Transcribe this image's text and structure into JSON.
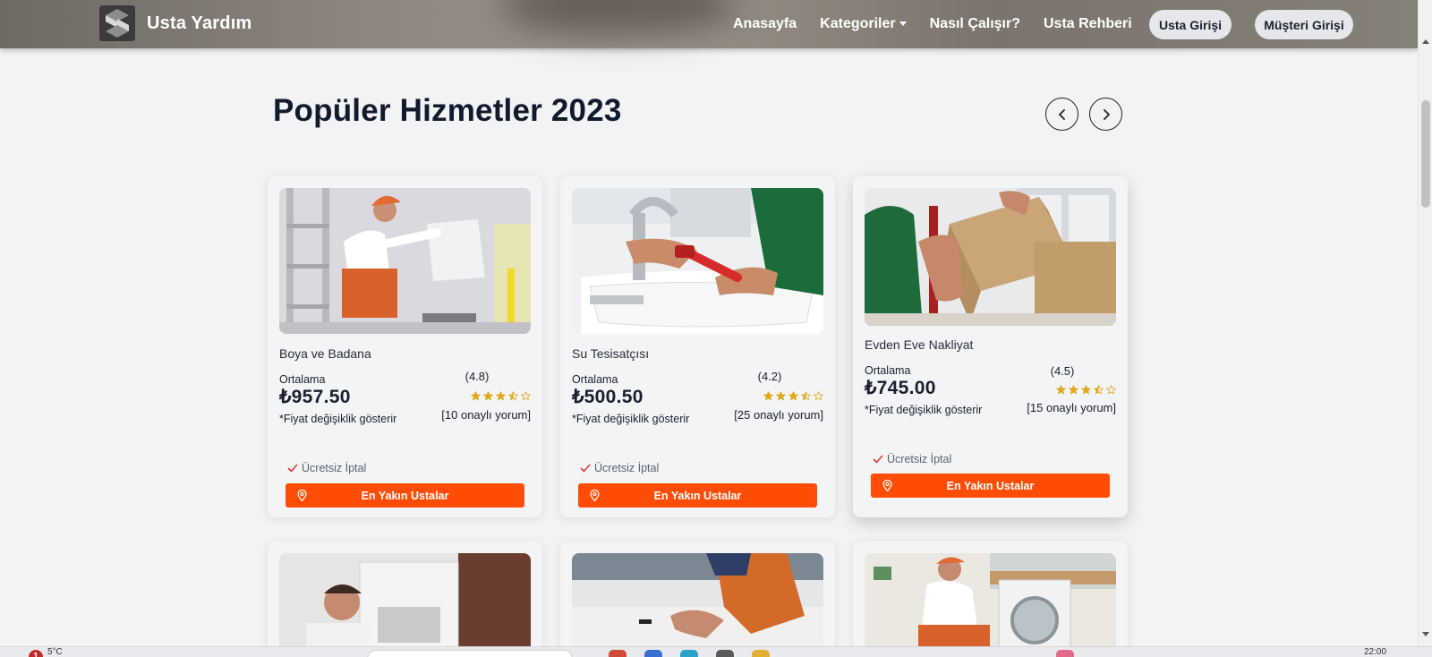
{
  "navbar": {
    "brand": "Usta Yardım",
    "links": [
      "Anasayfa",
      "Kategoriler",
      "Nasıl Çalışır?",
      "Usta Rehberi"
    ],
    "usta_login": "Usta Girişi",
    "customer_login": "Müşteri Girişi"
  },
  "section": {
    "title": "Popüler Hizmetler 2023"
  },
  "cards": [
    {
      "title": "Boya ve Badana",
      "avg_label": "Ortalama",
      "price": "₺957.50",
      "note": "*Fiyat değişiklik gösterir",
      "rating": "(4.8)",
      "stars": 3.5,
      "reviews": "[10 onaylı yorum]",
      "cancel": "Ücretsiz İptal",
      "cta": "En Yakın Ustalar"
    },
    {
      "title": "Su Tesisatçısı",
      "avg_label": "Ortalama",
      "price": "₺500.50",
      "note": "*Fiyat değişiklik gösterir",
      "rating": "(4.2)",
      "stars": 3.5,
      "reviews": "[25 onaylı yorum]",
      "cancel": "Ücretsiz İptal",
      "cta": "En Yakın Ustalar"
    },
    {
      "title": "Evden Eve Nakliyat",
      "avg_label": "Ortalama",
      "price": "₺745.00",
      "note": "*Fiyat değişiklik gösterir",
      "rating": "(4.5)",
      "stars": 3.5,
      "reviews": "[15 onaylı yorum]",
      "cancel": "Ücretsiz İptal",
      "cta": "En Yakın Ustalar"
    }
  ],
  "colors": {
    "accent": "#ff4d07",
    "star": "#e0a81c",
    "check": "#e53935"
  },
  "taskbar": {
    "badge": "1",
    "temp": "5°C",
    "clock": "22:00"
  }
}
